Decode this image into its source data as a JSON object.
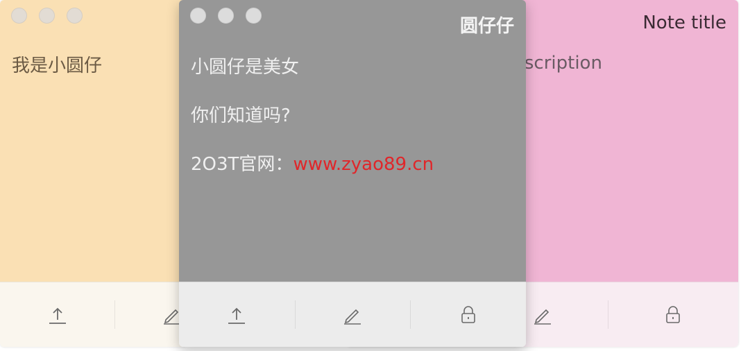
{
  "notes": {
    "yellow": {
      "text": "我是小圆仔",
      "ghost_title": "小圆仔"
    },
    "gray": {
      "title": "圆仔仔",
      "lines": [
        "小圆仔是美女",
        "你们知道吗?"
      ],
      "site_prefix": "2O3T官网：",
      "site_link": "www.zyao89.cn"
    },
    "pink": {
      "title": "Note title",
      "description": "This is the description"
    }
  },
  "toolbar": {
    "icons": [
      "upload-icon",
      "pencil-icon",
      "lock-icon"
    ]
  },
  "colors": {
    "yellow_note": "#fae0b4",
    "gray_note": "#979797",
    "pink_note": "#f0b5d4",
    "link": "#e0262a"
  }
}
